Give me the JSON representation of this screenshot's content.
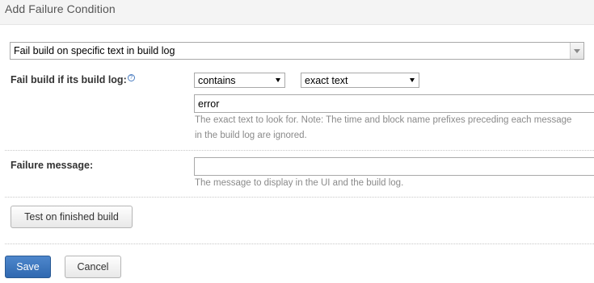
{
  "dialog": {
    "title": "Add Failure Condition"
  },
  "condition_type": {
    "selected": "Fail build on specific text in build log"
  },
  "build_log_row": {
    "label": "Fail build if its build log:",
    "help_glyph": "?",
    "match_mode": "contains",
    "match_type": "exact text",
    "text_value": "error",
    "note_line1": "The exact text to look for. Note: The time and block name prefixes preceding each message",
    "note_line2": "in the build log are ignored."
  },
  "message_row": {
    "label": "Failure message:",
    "value": "",
    "note": "The message to display in the UI and the build log."
  },
  "buttons": {
    "test_label": "Test on finished build",
    "save_label": "Save",
    "cancel_label": "Cancel"
  },
  "colors": {
    "primary_button": "#3a72ba",
    "header_bg": "#f4f4f4",
    "note_text": "#8a8a8a"
  }
}
